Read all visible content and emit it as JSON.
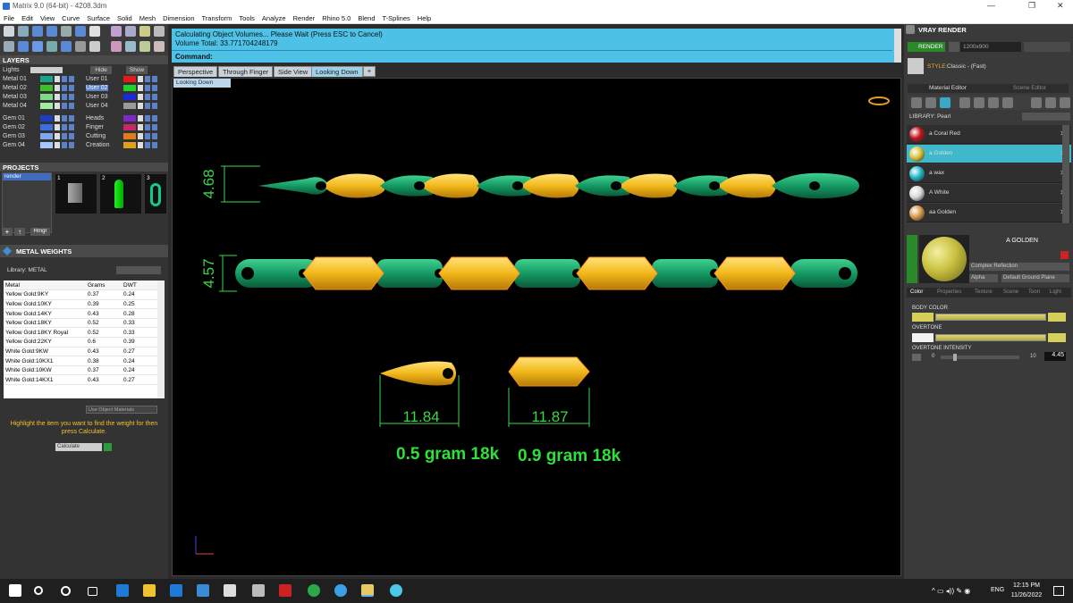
{
  "app": {
    "title": "Matrix 9.0 (64-bit) - 4208.3dm"
  },
  "window_controls": {
    "minimize": "—",
    "maximize": "❐",
    "close": "✕"
  },
  "menu": [
    "File",
    "Edit",
    "View",
    "Curve",
    "Surface",
    "Solid",
    "Mesh",
    "Dimension",
    "Transform",
    "Tools",
    "Analyze",
    "Render",
    "Rhino 5.0",
    "Blend",
    "T-Splines",
    "Help"
  ],
  "layers": {
    "title": "LAYERS",
    "lights": "Lights",
    "hide": "Hide",
    "show": "Show",
    "left": [
      {
        "name": "Metal 01",
        "color": "#1aa38a"
      },
      {
        "name": "Metal 02",
        "color": "#3fbf2a"
      },
      {
        "name": "Metal 03",
        "color": "#7fd98a"
      },
      {
        "name": "Metal 04",
        "color": "#9ef0a0"
      },
      {
        "name": "Gem 01",
        "color": "#1b3fc0"
      },
      {
        "name": "Gem 02",
        "color": "#3b6fe0"
      },
      {
        "name": "Gem 03",
        "color": "#7fa6f0"
      },
      {
        "name": "Gem 04",
        "color": "#a9c7ff"
      }
    ],
    "right": [
      {
        "name": "User 01",
        "color": "#e21a1a"
      },
      {
        "name": "User 02",
        "color": "#21d12a"
      },
      {
        "name": "User 03",
        "color": "#1a2ad6"
      },
      {
        "name": "User 04",
        "color": "#9a9a9a"
      },
      {
        "name": "Heads",
        "color": "#7b2ac6"
      },
      {
        "name": "Finger",
        "color": "#c42a6a"
      },
      {
        "name": "Cutting",
        "color": "#e07a1a"
      },
      {
        "name": "Creation",
        "color": "#e0a01a"
      }
    ]
  },
  "projects": {
    "title": "PROJECTS",
    "item": "render",
    "thumbs": [
      "1",
      "2",
      "3"
    ],
    "buttons": [
      "+",
      "↑",
      "Hrngr"
    ]
  },
  "metal_weights": {
    "title": "METAL WEIGHTS",
    "library": "Library: METAL",
    "cols": [
      "Metal",
      "Grams",
      "DWT"
    ],
    "rows": [
      [
        "Yellow Gold:9KY",
        "0.37",
        "0.24"
      ],
      [
        "Yellow Gold:10KY",
        "0.39",
        "0.25"
      ],
      [
        "Yellow Gold:14KY",
        "0.43",
        "0.28"
      ],
      [
        "Yellow Gold:18KY",
        "0.52",
        "0.33"
      ],
      [
        "Yellow Gold:18KY Royal",
        "0.52",
        "0.33"
      ],
      [
        "Yellow Gold:22KY",
        "0.6",
        "0.39"
      ],
      [
        "White Gold:9KW",
        "0.43",
        "0.27"
      ],
      [
        "White Gold:10KX1",
        "0.38",
        "0.24"
      ],
      [
        "White Gold:10KW",
        "0.37",
        "0.24"
      ],
      [
        "White Gold:14KX1",
        "0.43",
        "0.27"
      ]
    ],
    "use_object_materials": "Use Object Materials",
    "hint": "Highlight the item you want to find the weight for then press Calculate.",
    "calculate": "Calculate"
  },
  "command": {
    "line1": "Calculating Object Volumes... Please Wait (Press ESC to Cancel)",
    "line2": "Volume Total: 33.771704248179",
    "prompt": "Command:"
  },
  "viewtabs": [
    "Perspective",
    "Through Finger",
    "Side View",
    "Looking Down"
  ],
  "active_view_label": "Looking Down",
  "dims": {
    "d1": "4.68",
    "d2": "4.57",
    "d3": "11.84",
    "d4": "11.87",
    "w1": "0.5 gram 18k",
    "w2": "0.9 gram 18k"
  },
  "vray": {
    "title": "VRAY RENDER",
    "render": "RENDER",
    "resolution": "1200x900",
    "style_label": "STYLE:",
    "style": "Classic - (Fast)",
    "tabs": [
      "Material Editor",
      "Scene Editor"
    ],
    "library": "LIBRARY: Pearl",
    "materials": [
      {
        "name": "a Coral Red",
        "color": "#c0141a"
      },
      {
        "name": "a Golden",
        "color": "#d8c23a"
      },
      {
        "name": "a wax",
        "color": "#20b8c8"
      },
      {
        "name": "A White",
        "color": "#d8d8d8"
      },
      {
        "name": "aa Golden",
        "color": "#d89a4a"
      }
    ],
    "selected": "A GOLDEN",
    "reflection": "Complex Reflection",
    "alpha": "Alpha",
    "ground": "Default Ground Plane",
    "subtabs": [
      "Color",
      "Properties",
      "Texture",
      "Scene",
      "Toon",
      "Light"
    ],
    "body_color": "BODY COLOR",
    "overtone": "OVERTONE",
    "overtone_intensity": "OVERTONE INTENSITY",
    "int_min": "0",
    "int_max": "10",
    "int_val": "4.45"
  },
  "taskbar": {
    "time": "12:15 PM",
    "date": "11/26/2022",
    "lang": "ENG"
  }
}
